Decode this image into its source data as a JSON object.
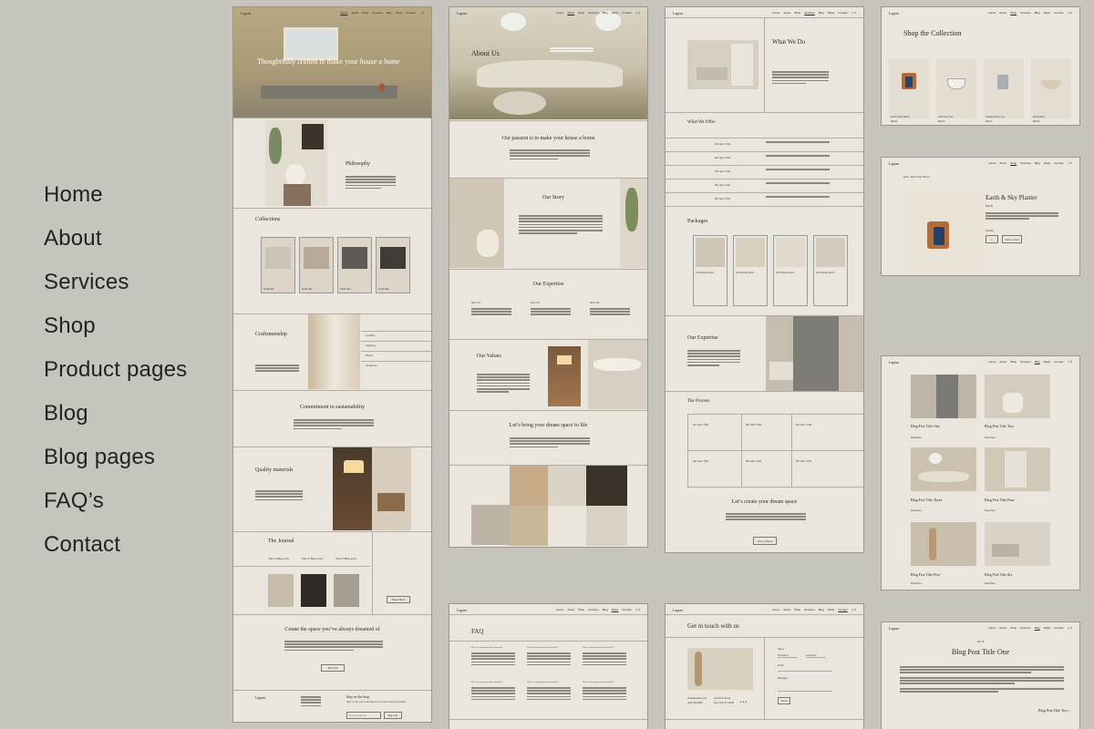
{
  "pages": [
    "Home",
    "About",
    "Services",
    "Shop",
    "Product pages",
    "Blog",
    "Blog pages",
    "FAQ’s",
    "Contact"
  ],
  "brand": "Lagom",
  "nav_links": [
    "Home",
    "About",
    "Shop",
    "Services",
    "Blog",
    "FAQs",
    "Contact"
  ],
  "cart": "🛒0",
  "home": {
    "hero": "Thoughtfully crafted to make your",
    "hero_em": "house a home",
    "philosophy": "Philosophy",
    "collections": "Collections",
    "collection_items": [
      "Sofa title",
      "Sofa title",
      "Sofa title",
      "Sofa title"
    ],
    "craftsmanship": "Craftsmenship",
    "craft_list": [
      "Leather",
      "Lighting",
      "Wood",
      "Ceramics"
    ],
    "sustainability": "Commitment to sustainability",
    "quality": "Quality materials",
    "journal": "The Journal",
    "journal_items": [
      "Title of Blog entry",
      "Title of Blog entry",
      "Title of Blog entry"
    ],
    "read_more": "Read More",
    "create": "Create the space you’ve always dreamed of",
    "shop_all": "Shop All",
    "stay": "Stay in the loop",
    "stay_text": "Sign up with your email address to receive news and updates.",
    "email_placeholder": "Email Address",
    "signup": "Sign Up"
  },
  "about": {
    "title": "About Us",
    "passion": "Our passion is to make your house a home",
    "story": "Our Story",
    "expertise": "Our Expertise",
    "items": [
      "Item 01",
      "Item 02",
      "Item 03"
    ],
    "values": "Our Values",
    "dream": "Let’s bring your dream space to life"
  },
  "services": {
    "what": "What We Do",
    "offer": "What We Offer",
    "offer_items": [
      "01/ Item Title",
      "02/ Item Title",
      "03/ Item Title",
      "04/ Item Title",
      "05/ Item Title"
    ],
    "packages": "Packages",
    "package_items": [
      "01/ Package $XXX",
      "02/ Package $XXX",
      "03/ Package $XXX",
      "04/ Package $XXX"
    ],
    "expertise": "Our Expertise",
    "process": "The Process",
    "process_items": [
      "01/ Item Title",
      "02/ Item Title",
      "03/ Item Title",
      "04/ Item Title",
      "05/ Item Title",
      "06/ Item Title"
    ],
    "dream": "Let’s create your dream space",
    "cta": "Get in Touch"
  },
  "shop": {
    "title": "Shop the Collection",
    "products": [
      "Earth & Sky Planter",
      "XXXX Key Cup",
      "Cobbled Stone Cup",
      "Spring Bowl"
    ],
    "prices": [
      "$00.00",
      "$00.00",
      "$00.00",
      "$00.00"
    ]
  },
  "product": {
    "breadcrumb": "Shop › Earth & Sky Planter",
    "name": "Earth & Sky Planter",
    "price": "$00.00",
    "qty_label": "Quantity",
    "qty": "1",
    "add": "Add to Cart"
  },
  "blog": {
    "posts": [
      "Blog Post Title One",
      "Blog Post Title Two",
      "Blog Post Title Three",
      "Blog Post Title Four",
      "Blog Post Title Five",
      "Blog Post Title Six"
    ],
    "read": "Read More"
  },
  "faq": {
    "title": "FAQ",
    "question": "This is a frequently asked question?"
  },
  "contact": {
    "title": "Get in touch with us",
    "email": "email@website.com",
    "phone": "(000) 000-0000",
    "address1": "123 Demo Street",
    "address2": "New York, NY 12345",
    "name_label": "Name",
    "first": "First Name",
    "last": "Last Name",
    "email_label": "Email",
    "message_label": "Message",
    "send": "Send"
  },
  "blog_page": {
    "date": "Mar 16",
    "title": "Blog Post Title One",
    "next": "Blog Post Title Two"
  },
  "colors": {
    "background": "#c7c4bd",
    "page": "#ebe6dd",
    "line": "#b3ad9f"
  }
}
